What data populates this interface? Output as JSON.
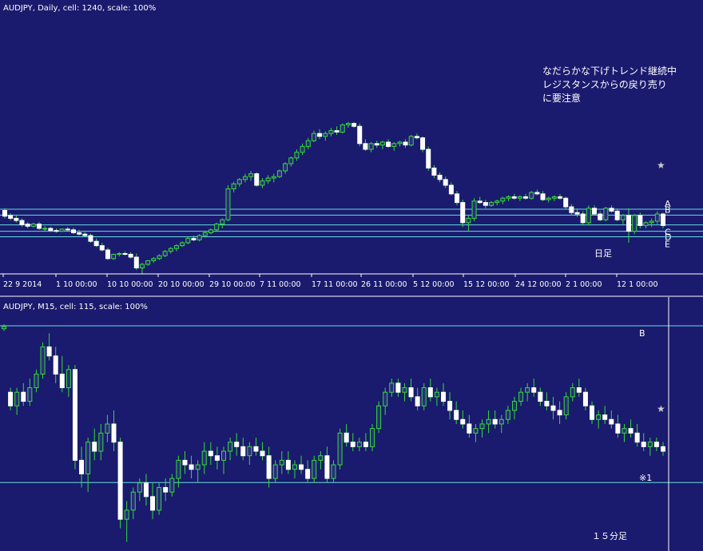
{
  "chart_data": [
    {
      "type": "candlestick",
      "title": "AUDJPY, Daily, cell: 1240, scale: 100%",
      "timeframe_label": "日足",
      "annotation": [
        "なだらかな下げトレンド継続中",
        "レジスタンスからの戻り売り",
        "に要注意"
      ],
      "x_ticks": [
        "22 9 2014",
        "1 10 00:00",
        "10 10 00:00",
        "20 10 00:00",
        "29 10 00:00",
        "7 11 00:00",
        "17 11 00:00",
        "26 11 00:00",
        "5 12 00:00",
        "15 12 00:00",
        "24 12 00:00",
        "2 1 00:00",
        "12 1 00:00"
      ],
      "levels": [
        {
          "label": "A",
          "value": 0.866
        },
        {
          "label": "B",
          "value": 0.785
        },
        {
          "label": "C",
          "value": 0.648
        },
        {
          "label": "D",
          "value": 0.56
        },
        {
          "label": "E",
          "value": 0.484
        }
      ],
      "star_label": "★",
      "y_range": [
        0.0,
        1.0
      ],
      "candles": [
        [
          0.85,
          0.88,
          0.74,
          0.77
        ],
        [
          0.78,
          0.81,
          0.71,
          0.74
        ],
        [
          0.74,
          0.78,
          0.68,
          0.71
        ],
        [
          0.71,
          0.74,
          0.62,
          0.65
        ],
        [
          0.66,
          0.69,
          0.6,
          0.63
        ],
        [
          0.63,
          0.68,
          0.61,
          0.66
        ],
        [
          0.66,
          0.69,
          0.58,
          0.6
        ],
        [
          0.6,
          0.63,
          0.56,
          0.6
        ],
        [
          0.6,
          0.62,
          0.55,
          0.57
        ],
        [
          0.57,
          0.6,
          0.54,
          0.56
        ],
        [
          0.56,
          0.6,
          0.55,
          0.59
        ],
        [
          0.59,
          0.62,
          0.56,
          0.58
        ],
        [
          0.58,
          0.61,
          0.52,
          0.54
        ],
        [
          0.54,
          0.58,
          0.5,
          0.52
        ],
        [
          0.52,
          0.55,
          0.48,
          0.5
        ],
        [
          0.5,
          0.53,
          0.4,
          0.42
        ],
        [
          0.42,
          0.46,
          0.34,
          0.36
        ],
        [
          0.36,
          0.4,
          0.28,
          0.3
        ],
        [
          0.3,
          0.33,
          0.16,
          0.18
        ],
        [
          0.18,
          0.25,
          0.16,
          0.24
        ],
        [
          0.24,
          0.27,
          0.21,
          0.25
        ],
        [
          0.25,
          0.28,
          0.22,
          0.24
        ],
        [
          0.24,
          0.27,
          0.18,
          0.2
        ],
        [
          0.2,
          0.25,
          0.02,
          0.05
        ],
        [
          0.05,
          0.12,
          -0.04,
          0.1
        ],
        [
          0.1,
          0.16,
          0.08,
          0.15
        ],
        [
          0.15,
          0.2,
          0.12,
          0.18
        ],
        [
          0.18,
          0.24,
          0.16,
          0.22
        ],
        [
          0.22,
          0.3,
          0.2,
          0.28
        ],
        [
          0.28,
          0.34,
          0.25,
          0.32
        ],
        [
          0.32,
          0.38,
          0.28,
          0.36
        ],
        [
          0.36,
          0.42,
          0.34,
          0.4
        ],
        [
          0.4,
          0.48,
          0.38,
          0.46
        ],
        [
          0.46,
          0.5,
          0.42,
          0.44
        ],
        [
          0.44,
          0.52,
          0.42,
          0.5
        ],
        [
          0.5,
          0.56,
          0.47,
          0.54
        ],
        [
          0.54,
          0.6,
          0.52,
          0.58
        ],
        [
          0.58,
          0.68,
          0.56,
          0.66
        ],
        [
          0.66,
          0.74,
          0.6,
          0.72
        ],
        [
          0.72,
          1.2,
          0.7,
          1.15
        ],
        [
          1.15,
          1.25,
          1.1,
          1.22
        ],
        [
          1.22,
          1.3,
          1.18,
          1.28
        ],
        [
          1.28,
          1.36,
          1.24,
          1.32
        ],
        [
          1.32,
          1.4,
          1.26,
          1.36
        ],
        [
          1.36,
          1.38,
          1.18,
          1.2
        ],
        [
          1.2,
          1.3,
          1.16,
          1.26
        ],
        [
          1.26,
          1.34,
          1.22,
          1.3
        ],
        [
          1.3,
          1.36,
          1.24,
          1.32
        ],
        [
          1.32,
          1.42,
          1.3,
          1.4
        ],
        [
          1.4,
          1.52,
          1.36,
          1.5
        ],
        [
          1.5,
          1.6,
          1.46,
          1.58
        ],
        [
          1.58,
          1.7,
          1.54,
          1.66
        ],
        [
          1.66,
          1.78,
          1.62,
          1.74
        ],
        [
          1.74,
          1.86,
          1.7,
          1.82
        ],
        [
          1.82,
          1.96,
          1.8,
          1.92
        ],
        [
          1.92,
          1.98,
          1.84,
          1.88
        ],
        [
          1.88,
          1.95,
          1.82,
          1.92
        ],
        [
          1.92,
          2.0,
          1.88,
          1.96
        ],
        [
          1.96,
          2.02,
          1.9,
          1.94
        ],
        [
          1.94,
          2.06,
          1.92,
          2.04
        ],
        [
          2.04,
          2.08,
          2.0,
          2.06
        ],
        [
          2.06,
          2.08,
          2.0,
          2.02
        ],
        [
          2.02,
          2.06,
          1.74,
          1.78
        ],
        [
          1.78,
          1.84,
          1.68,
          1.7
        ],
        [
          1.7,
          1.8,
          1.66,
          1.78
        ],
        [
          1.78,
          1.82,
          1.72,
          1.76
        ],
        [
          1.76,
          1.82,
          1.7,
          1.8
        ],
        [
          1.8,
          1.84,
          1.72,
          1.74
        ],
        [
          1.74,
          1.8,
          1.68,
          1.78
        ],
        [
          1.78,
          1.82,
          1.74,
          1.8
        ],
        [
          1.8,
          1.84,
          1.72,
          1.76
        ],
        [
          1.76,
          1.9,
          1.74,
          1.88
        ],
        [
          1.88,
          1.92,
          1.84,
          1.86
        ],
        [
          1.86,
          1.88,
          1.66,
          1.7
        ],
        [
          1.7,
          1.74,
          1.4,
          1.44
        ],
        [
          1.44,
          1.48,
          1.3,
          1.34
        ],
        [
          1.34,
          1.38,
          1.24,
          1.28
        ],
        [
          1.28,
          1.32,
          1.16,
          1.2
        ],
        [
          1.2,
          1.24,
          1.06,
          1.08
        ],
        [
          1.08,
          1.12,
          0.92,
          0.96
        ],
        [
          0.96,
          1.0,
          0.62,
          0.68
        ],
        [
          0.68,
          0.78,
          0.56,
          0.74
        ],
        [
          0.74,
          1.02,
          0.7,
          0.98
        ],
        [
          0.98,
          1.04,
          0.94,
          0.96
        ],
        [
          0.96,
          1.0,
          0.88,
          0.92
        ],
        [
          0.92,
          0.98,
          0.9,
          0.96
        ],
        [
          0.96,
          1.0,
          0.92,
          0.98
        ],
        [
          0.98,
          1.04,
          0.94,
          1.02
        ],
        [
          1.02,
          1.06,
          0.98,
          1.04
        ],
        [
          1.04,
          1.08,
          1.0,
          1.02
        ],
        [
          1.02,
          1.06,
          0.98,
          1.04
        ],
        [
          1.04,
          1.08,
          1.0,
          1.02
        ],
        [
          1.02,
          1.12,
          1.0,
          1.1
        ],
        [
          1.1,
          1.14,
          1.06,
          1.08
        ],
        [
          1.08,
          1.12,
          0.98,
          1.0
        ],
        [
          1.0,
          1.04,
          0.96,
          1.02
        ],
        [
          1.02,
          1.06,
          0.98,
          1.04
        ],
        [
          1.04,
          1.08,
          1.0,
          1.02
        ],
        [
          1.02,
          1.04,
          0.86,
          0.9
        ],
        [
          0.9,
          0.94,
          0.78,
          0.82
        ],
        [
          0.82,
          0.88,
          0.76,
          0.8
        ],
        [
          0.8,
          0.84,
          0.64,
          0.68
        ],
        [
          0.68,
          0.92,
          0.64,
          0.88
        ],
        [
          0.88,
          0.92,
          0.78,
          0.8
        ],
        [
          0.8,
          0.84,
          0.7,
          0.72
        ],
        [
          0.72,
          0.9,
          0.7,
          0.88
        ],
        [
          0.88,
          0.92,
          0.82,
          0.84
        ],
        [
          0.84,
          0.88,
          0.7,
          0.72
        ],
        [
          0.72,
          0.8,
          0.66,
          0.78
        ],
        [
          0.78,
          0.88,
          0.4,
          0.56
        ],
        [
          0.56,
          0.8,
          0.52,
          0.78
        ],
        [
          0.78,
          0.82,
          0.6,
          0.64
        ],
        [
          0.64,
          0.7,
          0.6,
          0.68
        ],
        [
          0.68,
          0.74,
          0.62,
          0.7
        ],
        [
          0.7,
          0.84,
          0.66,
          0.8
        ],
        [
          0.8,
          0.82,
          0.6,
          0.64
        ]
      ]
    },
    {
      "type": "candlestick",
      "title": "AUDJPY, M15, cell: 115, scale: 100%",
      "timeframe_label": "１５分足",
      "levels": [
        {
          "label": "B",
          "value": 0.993
        },
        {
          "label": "※1",
          "value": 0.302
        }
      ],
      "star_label": "★",
      "y_range": [
        0.0,
        1.0
      ],
      "candles": [
        [
          0.98,
          1.0,
          0.97,
          0.99
        ],
        [
          0.7,
          0.72,
          0.62,
          0.64
        ],
        [
          0.64,
          0.72,
          0.6,
          0.7
        ],
        [
          0.7,
          0.74,
          0.64,
          0.66
        ],
        [
          0.66,
          0.76,
          0.64,
          0.72
        ],
        [
          0.72,
          0.8,
          0.7,
          0.78
        ],
        [
          0.78,
          0.92,
          0.76,
          0.9
        ],
        [
          0.9,
          0.96,
          0.84,
          0.86
        ],
        [
          0.86,
          0.9,
          0.74,
          0.78
        ],
        [
          0.78,
          0.86,
          0.7,
          0.72
        ],
        [
          0.72,
          0.82,
          0.68,
          0.8
        ],
        [
          0.8,
          0.82,
          0.36,
          0.4
        ],
        [
          0.4,
          0.46,
          0.28,
          0.34
        ],
        [
          0.34,
          0.5,
          0.26,
          0.48
        ],
        [
          0.48,
          0.54,
          0.4,
          0.44
        ],
        [
          0.44,
          0.56,
          0.4,
          0.52
        ],
        [
          0.52,
          0.6,
          0.48,
          0.56
        ],
        [
          0.56,
          0.62,
          0.44,
          0.48
        ],
        [
          0.48,
          0.5,
          0.1,
          0.14
        ],
        [
          0.14,
          0.22,
          0.04,
          0.18
        ],
        [
          0.18,
          0.28,
          0.14,
          0.26
        ],
        [
          0.26,
          0.32,
          0.22,
          0.3
        ],
        [
          0.3,
          0.34,
          0.2,
          0.24
        ],
        [
          0.24,
          0.3,
          0.14,
          0.18
        ],
        [
          0.18,
          0.3,
          0.16,
          0.28
        ],
        [
          0.28,
          0.32,
          0.22,
          0.26
        ],
        [
          0.26,
          0.34,
          0.24,
          0.32
        ],
        [
          0.32,
          0.42,
          0.28,
          0.4
        ],
        [
          0.4,
          0.44,
          0.34,
          0.38
        ],
        [
          0.38,
          0.42,
          0.32,
          0.36
        ],
        [
          0.36,
          0.4,
          0.3,
          0.38
        ],
        [
          0.38,
          0.48,
          0.34,
          0.44
        ],
        [
          0.44,
          0.48,
          0.38,
          0.42
        ],
        [
          0.42,
          0.46,
          0.36,
          0.4
        ],
        [
          0.4,
          0.46,
          0.34,
          0.44
        ],
        [
          0.44,
          0.5,
          0.4,
          0.48
        ],
        [
          0.48,
          0.52,
          0.42,
          0.46
        ],
        [
          0.46,
          0.5,
          0.4,
          0.42
        ],
        [
          0.42,
          0.48,
          0.38,
          0.46
        ],
        [
          0.46,
          0.5,
          0.42,
          0.44
        ],
        [
          0.44,
          0.48,
          0.4,
          0.42
        ],
        [
          0.42,
          0.46,
          0.28,
          0.32
        ],
        [
          0.32,
          0.4,
          0.3,
          0.38
        ],
        [
          0.38,
          0.44,
          0.34,
          0.4
        ],
        [
          0.4,
          0.44,
          0.34,
          0.36
        ],
        [
          0.36,
          0.4,
          0.32,
          0.38
        ],
        [
          0.38,
          0.42,
          0.34,
          0.36
        ],
        [
          0.36,
          0.4,
          0.3,
          0.32
        ],
        [
          0.32,
          0.42,
          0.3,
          0.4
        ],
        [
          0.4,
          0.44,
          0.36,
          0.42
        ],
        [
          0.42,
          0.46,
          0.3,
          0.32
        ],
        [
          0.32,
          0.4,
          0.3,
          0.38
        ],
        [
          0.38,
          0.54,
          0.36,
          0.52
        ],
        [
          0.52,
          0.56,
          0.46,
          0.48
        ],
        [
          0.48,
          0.52,
          0.44,
          0.46
        ],
        [
          0.46,
          0.5,
          0.44,
          0.48
        ],
        [
          0.48,
          0.52,
          0.44,
          0.46
        ],
        [
          0.46,
          0.56,
          0.44,
          0.54
        ],
        [
          0.54,
          0.66,
          0.52,
          0.64
        ],
        [
          0.64,
          0.72,
          0.6,
          0.7
        ],
        [
          0.7,
          0.76,
          0.68,
          0.74
        ],
        [
          0.74,
          0.76,
          0.68,
          0.7
        ],
        [
          0.7,
          0.74,
          0.66,
          0.72
        ],
        [
          0.72,
          0.76,
          0.66,
          0.68
        ],
        [
          0.68,
          0.72,
          0.62,
          0.64
        ],
        [
          0.64,
          0.74,
          0.62,
          0.72
        ],
        [
          0.72,
          0.76,
          0.66,
          0.68
        ],
        [
          0.68,
          0.72,
          0.64,
          0.7
        ],
        [
          0.7,
          0.74,
          0.64,
          0.66
        ],
        [
          0.66,
          0.7,
          0.58,
          0.62
        ],
        [
          0.62,
          0.66,
          0.56,
          0.58
        ],
        [
          0.58,
          0.62,
          0.54,
          0.56
        ],
        [
          0.56,
          0.6,
          0.5,
          0.52
        ],
        [
          0.52,
          0.56,
          0.48,
          0.54
        ],
        [
          0.54,
          0.58,
          0.5,
          0.56
        ],
        [
          0.56,
          0.62,
          0.52,
          0.58
        ],
        [
          0.58,
          0.62,
          0.54,
          0.56
        ],
        [
          0.56,
          0.6,
          0.52,
          0.58
        ],
        [
          0.58,
          0.64,
          0.56,
          0.62
        ],
        [
          0.62,
          0.68,
          0.58,
          0.66
        ],
        [
          0.66,
          0.72,
          0.64,
          0.7
        ],
        [
          0.7,
          0.74,
          0.66,
          0.72
        ],
        [
          0.72,
          0.76,
          0.68,
          0.7
        ],
        [
          0.7,
          0.72,
          0.64,
          0.66
        ],
        [
          0.66,
          0.7,
          0.62,
          0.64
        ],
        [
          0.64,
          0.68,
          0.58,
          0.62
        ],
        [
          0.62,
          0.66,
          0.56,
          0.6
        ],
        [
          0.6,
          0.7,
          0.58,
          0.68
        ],
        [
          0.68,
          0.74,
          0.66,
          0.72
        ],
        [
          0.72,
          0.76,
          0.68,
          0.7
        ],
        [
          0.7,
          0.72,
          0.62,
          0.64
        ],
        [
          0.64,
          0.66,
          0.56,
          0.58
        ],
        [
          0.58,
          0.62,
          0.54,
          0.6
        ],
        [
          0.6,
          0.64,
          0.56,
          0.58
        ],
        [
          0.58,
          0.62,
          0.54,
          0.56
        ],
        [
          0.56,
          0.6,
          0.5,
          0.52
        ],
        [
          0.52,
          0.56,
          0.48,
          0.54
        ],
        [
          0.54,
          0.58,
          0.5,
          0.52
        ],
        [
          0.52,
          0.56,
          0.46,
          0.48
        ],
        [
          0.48,
          0.52,
          0.44,
          0.46
        ],
        [
          0.46,
          0.5,
          0.42,
          0.48
        ],
        [
          0.48,
          0.5,
          0.44,
          0.46
        ],
        [
          0.46,
          0.48,
          0.42,
          0.44
        ]
      ]
    }
  ],
  "style": {
    "background": "#1a1a6e",
    "line": "#66dddd",
    "grid_line": "#ffffff",
    "bull": "#2a2a80",
    "bear": "#ffffff",
    "wick": "#33dd33",
    "text": "#ffffff"
  }
}
